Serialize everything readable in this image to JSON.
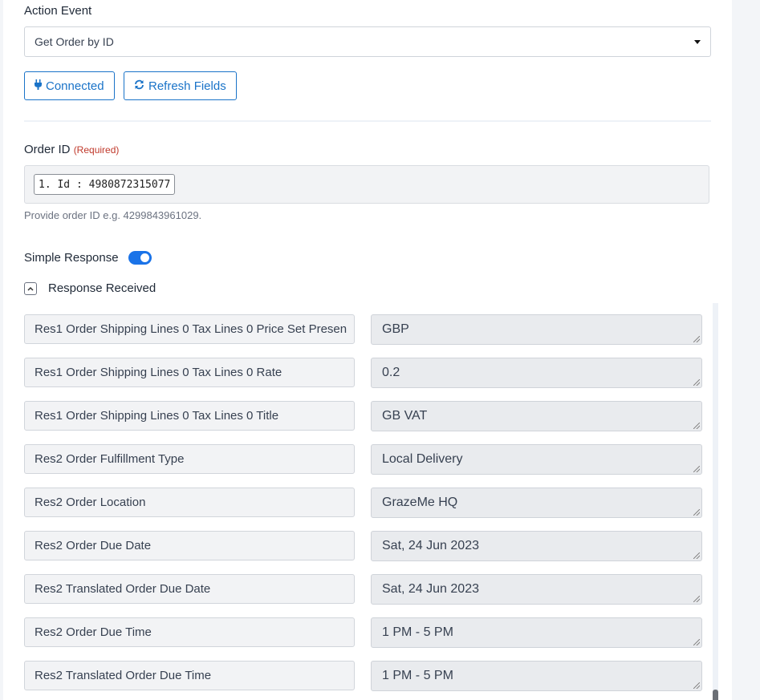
{
  "action_event": {
    "label": "Action Event",
    "selected": "Get Order by ID"
  },
  "buttons": {
    "connected": "Connected",
    "connected_icon": "plug-icon",
    "refresh": "Refresh Fields",
    "refresh_icon": "refresh-icon"
  },
  "order_id": {
    "label": "Order ID",
    "required": "(Required)",
    "chip": "1. Id : 4980872315077",
    "help": "Provide order ID e.g. 4299843961029."
  },
  "simple_response": {
    "label": "Simple Response",
    "enabled": true
  },
  "response": {
    "label": "Response Received",
    "rows": [
      {
        "key": "Res1 Order Shipping Lines 0 Tax Lines 0 Price Set Presen",
        "value": "GBP"
      },
      {
        "key": "Res1 Order Shipping Lines 0 Tax Lines 0 Rate",
        "value": "0.2"
      },
      {
        "key": "Res1 Order Shipping Lines 0 Tax Lines 0 Title",
        "value": "GB VAT"
      },
      {
        "key": "Res2 Order Fulfillment Type",
        "value": "Local Delivery"
      },
      {
        "key": "Res2 Order Location",
        "value": "GrazeMe HQ"
      },
      {
        "key": "Res2 Order Due Date",
        "value": "Sat, 24 Jun 2023"
      },
      {
        "key": "Res2 Translated Order Due Date",
        "value": "Sat, 24 Jun 2023"
      },
      {
        "key": "Res2 Order Due Time",
        "value": "1 PM - 5 PM"
      },
      {
        "key": "Res2 Translated Order Due Time",
        "value": "1 PM - 5 PM"
      }
    ]
  },
  "colors": {
    "accent": "#1a73c8",
    "required": "#c0392b",
    "toggle_on": "#1a73e8"
  }
}
